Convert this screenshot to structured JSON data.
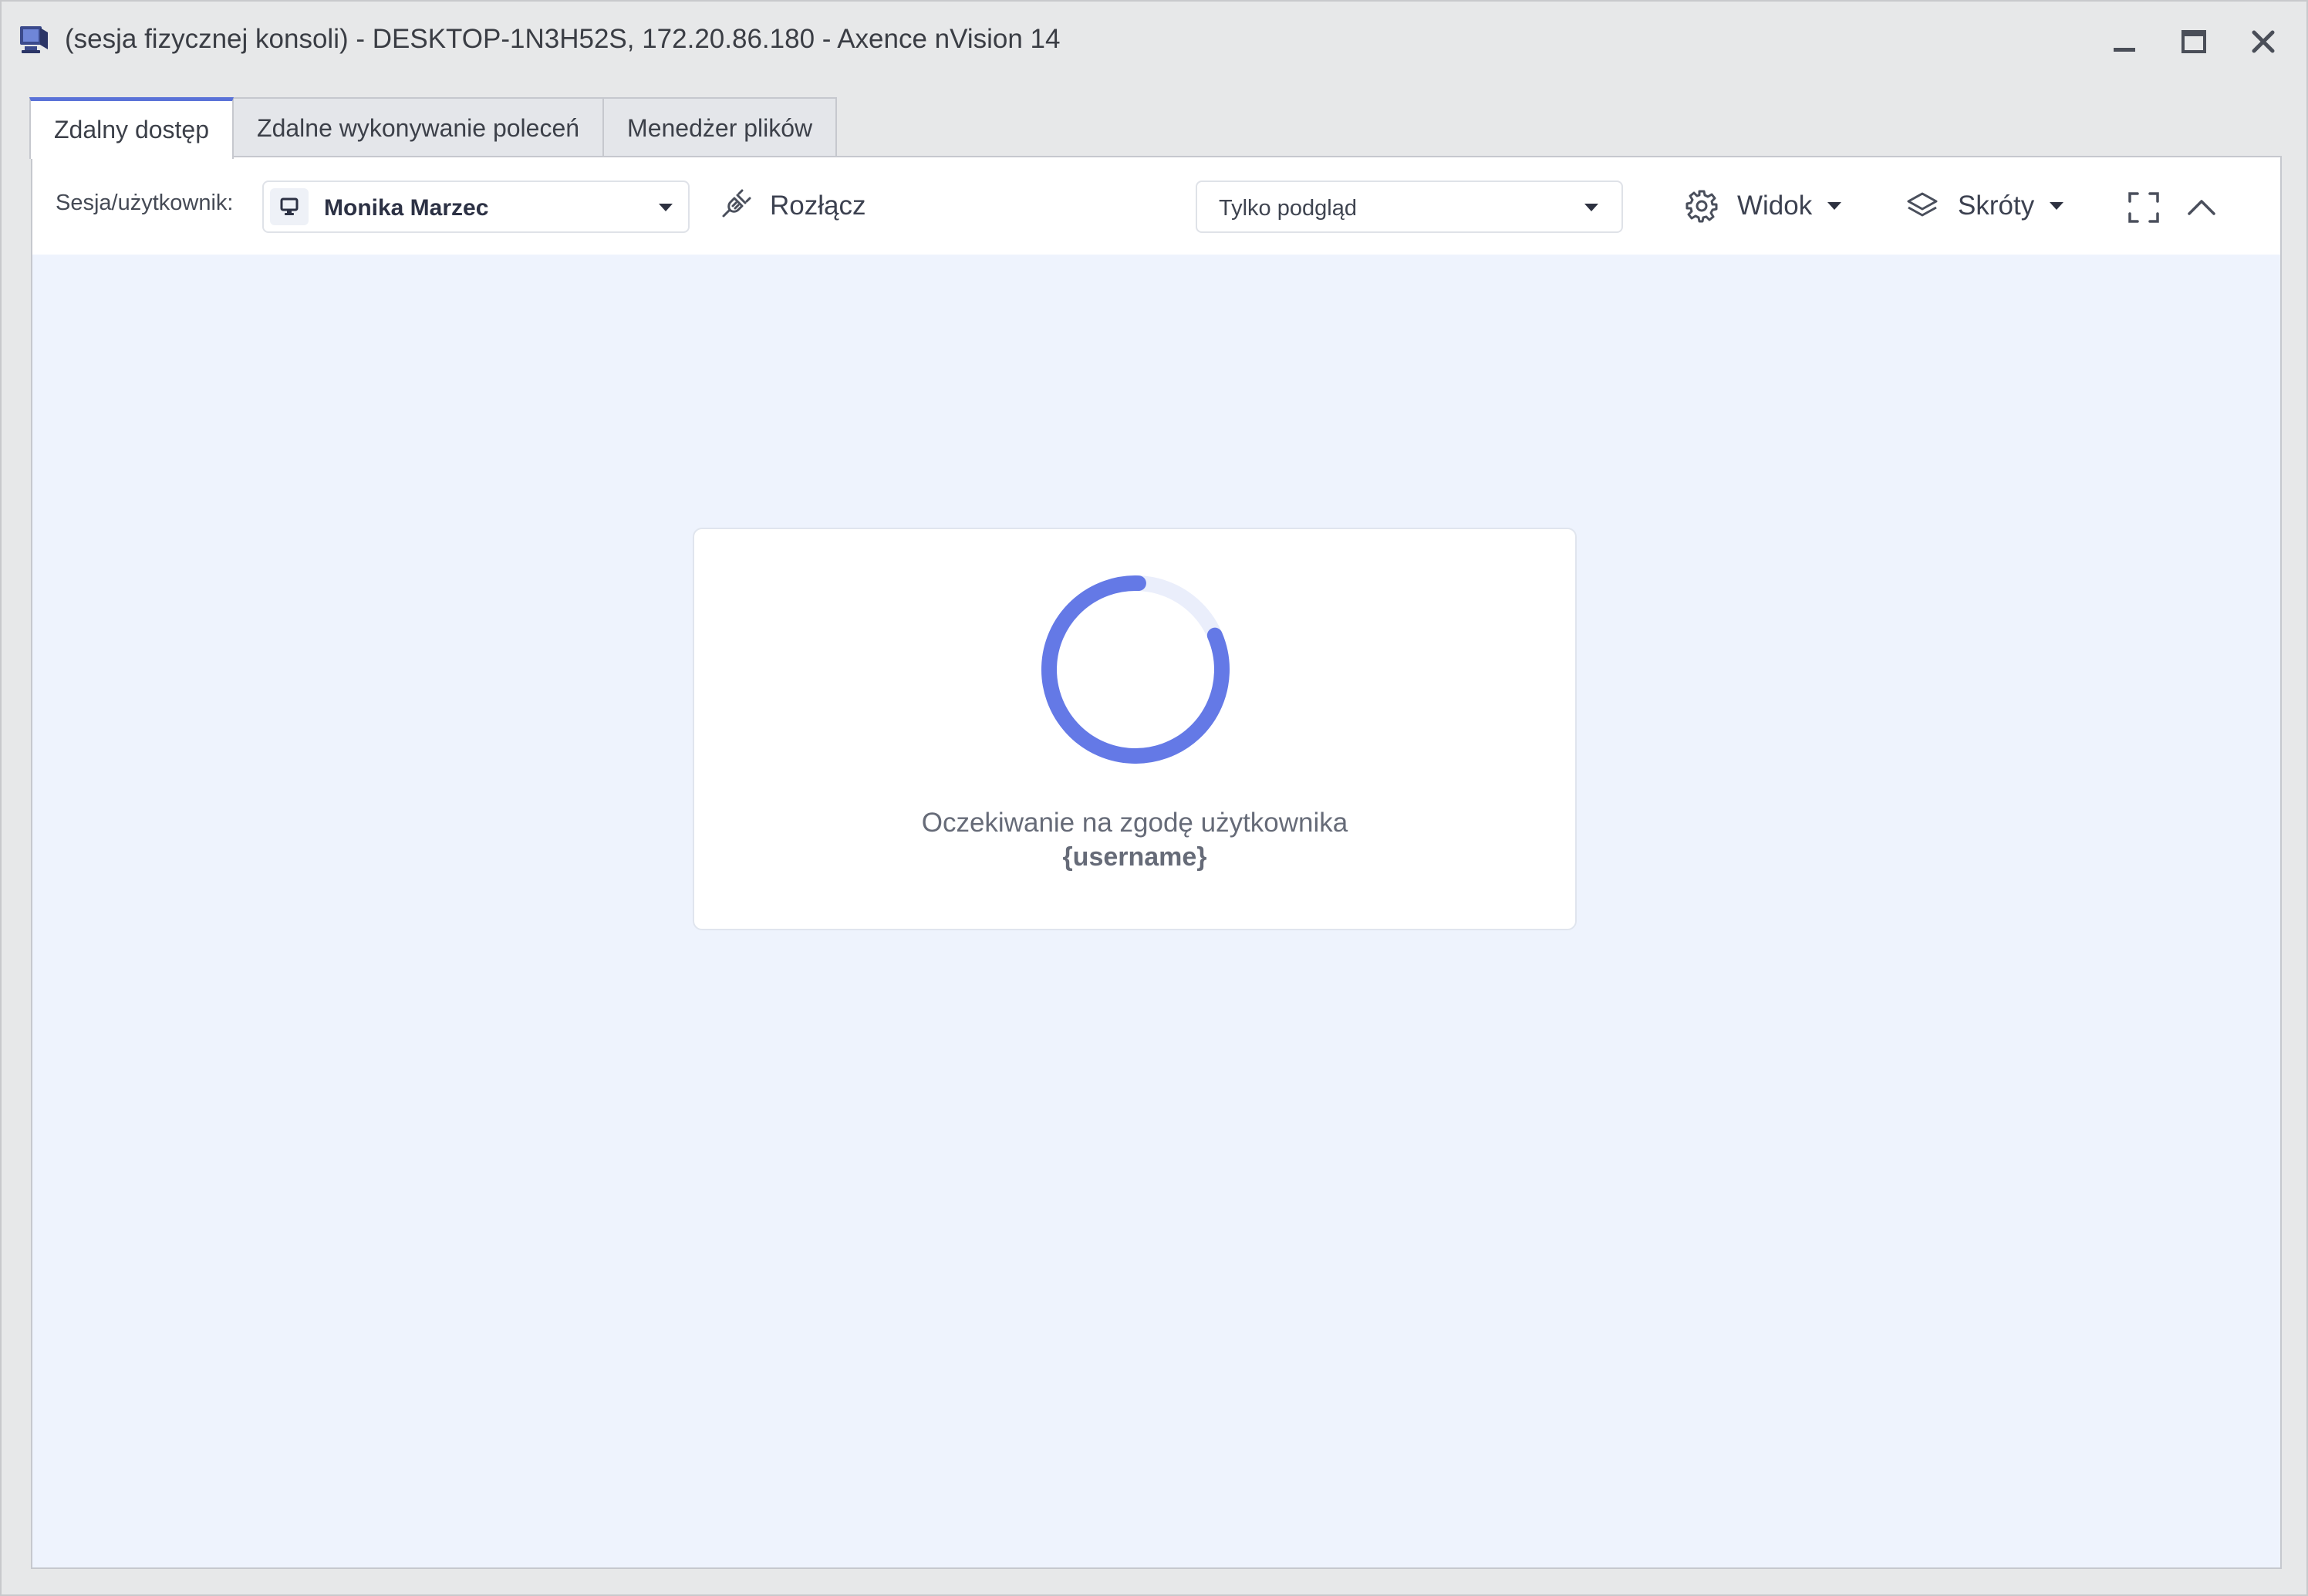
{
  "window": {
    "title": "(sesja fizycznej konsoli) - DESKTOP-1N3H52S, 172.20.86.180 - Axence nVision 14",
    "app_icon": "monitor-app-icon",
    "controls": {
      "minimize_icon": "minimize-icon",
      "maximize_icon": "maximize-icon",
      "close_icon": "close-icon"
    }
  },
  "tabs": [
    {
      "label": "Zdalny dostęp",
      "active": true
    },
    {
      "label": "Zdalne wykonywanie poleceń",
      "active": false
    },
    {
      "label": "Menedżer plików",
      "active": false
    }
  ],
  "toolbar": {
    "session_label": "Sesja/użytkownik:",
    "session_value": "Monika Marzec",
    "session_icon": "monitor-icon",
    "disconnect_label": "Rozłącz",
    "disconnect_icon": "unplug-icon",
    "mode_value": "Tylko podgląd",
    "view_label": "Widok",
    "view_icon": "gear-icon",
    "shortcuts_label": "Skróty",
    "shortcuts_icon": "layers-icon",
    "fullscreen_icon": "fullscreen-icon",
    "collapse_icon": "chevron-up-icon"
  },
  "waiting": {
    "message": "Oczekiwanie na zgodę użytkownika",
    "username": "{username}",
    "progress_fraction": 0.82
  },
  "colors": {
    "accent": "#5a72d8",
    "spinner": "#6479e6",
    "spinner_track": "#eaeefb",
    "content_bg": "#eef3fd",
    "window_bg": "#e7e8e9"
  }
}
